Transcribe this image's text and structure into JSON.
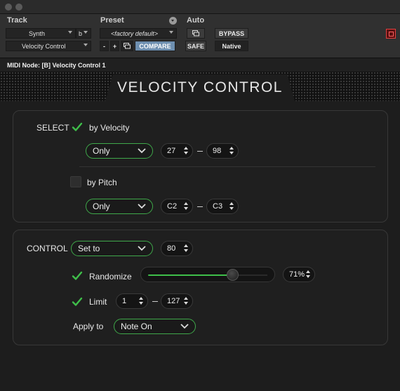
{
  "header": {
    "track_label": "Track",
    "preset_label": "Preset",
    "auto_label": "Auto",
    "track_name": "Synth",
    "track_channel": "b",
    "plugin_name": "Velocity Control",
    "preset_name": "<factory default>",
    "minus": "-",
    "plus": "+",
    "compare": "COMPARE",
    "bypass": "BYPASS",
    "safe": "SAFE",
    "native": "Native"
  },
  "node_bar": {
    "text": "MIDI Node: [B] Velocity Control 1"
  },
  "banner": {
    "title": "VELOCITY CONTROL"
  },
  "select": {
    "section_label": "SELECT",
    "by_velocity": {
      "label": "by Velocity",
      "checked": true,
      "mode": "Only",
      "low": "27",
      "high": "98"
    },
    "by_pitch": {
      "label": "by Pitch",
      "checked": false,
      "mode": "Only",
      "low": "C2",
      "high": "C3"
    }
  },
  "control": {
    "section_label": "CONTROL",
    "mode": "Set to",
    "value": "80",
    "randomize": {
      "label": "Randomize",
      "checked": true,
      "value_text": "71%",
      "level": 0.71
    },
    "limit": {
      "label": "Limit",
      "checked": true,
      "low": "1",
      "high": "127"
    },
    "apply_to": {
      "label": "Apply to",
      "value": "Note On"
    }
  },
  "colors": {
    "accent_green": "#3fa84a",
    "compare_blue": "#6e8fb0",
    "close_red": "#e04040"
  }
}
